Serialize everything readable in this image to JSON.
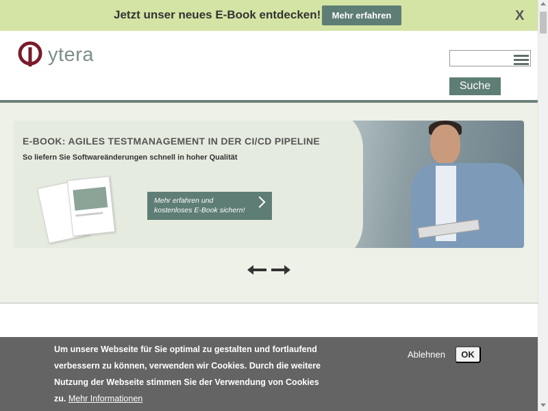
{
  "promo": {
    "text": "Jetzt unser neues E-Book entdecken!",
    "button_label": "Mehr erfahren",
    "close_label": "X"
  },
  "header": {
    "logo_text": "ytera",
    "search_value": "",
    "search_button_label": "Suche"
  },
  "banner": {
    "title": "E-BOOK: AGILES TESTMANAGEMENT IN DER CI/CD PIPELINE",
    "subtitle": "So liefern Sie Softwareänderungen schnell in hoher Qualität",
    "cta_line1": "Mehr erfahren und",
    "cta_line2": "kostenloses E-Book sichern!"
  },
  "cookie": {
    "text": "Um unsere Webseite für Sie optimal zu gestalten und fortlaufend verbessern zu können, verwenden wir Cookies. Durch die weitere Nutzung der Webseite stimmen Sie der Verwendung von Cookies zu.",
    "link_label": "Mehr Informationen",
    "decline_label": "Ablehnen",
    "accept_label": "OK"
  },
  "colors": {
    "promo_bg": "#d4e4a4",
    "accent": "#5e7d74",
    "logo_red": "#7a1a2a",
    "cookie_bg": "#646464"
  }
}
